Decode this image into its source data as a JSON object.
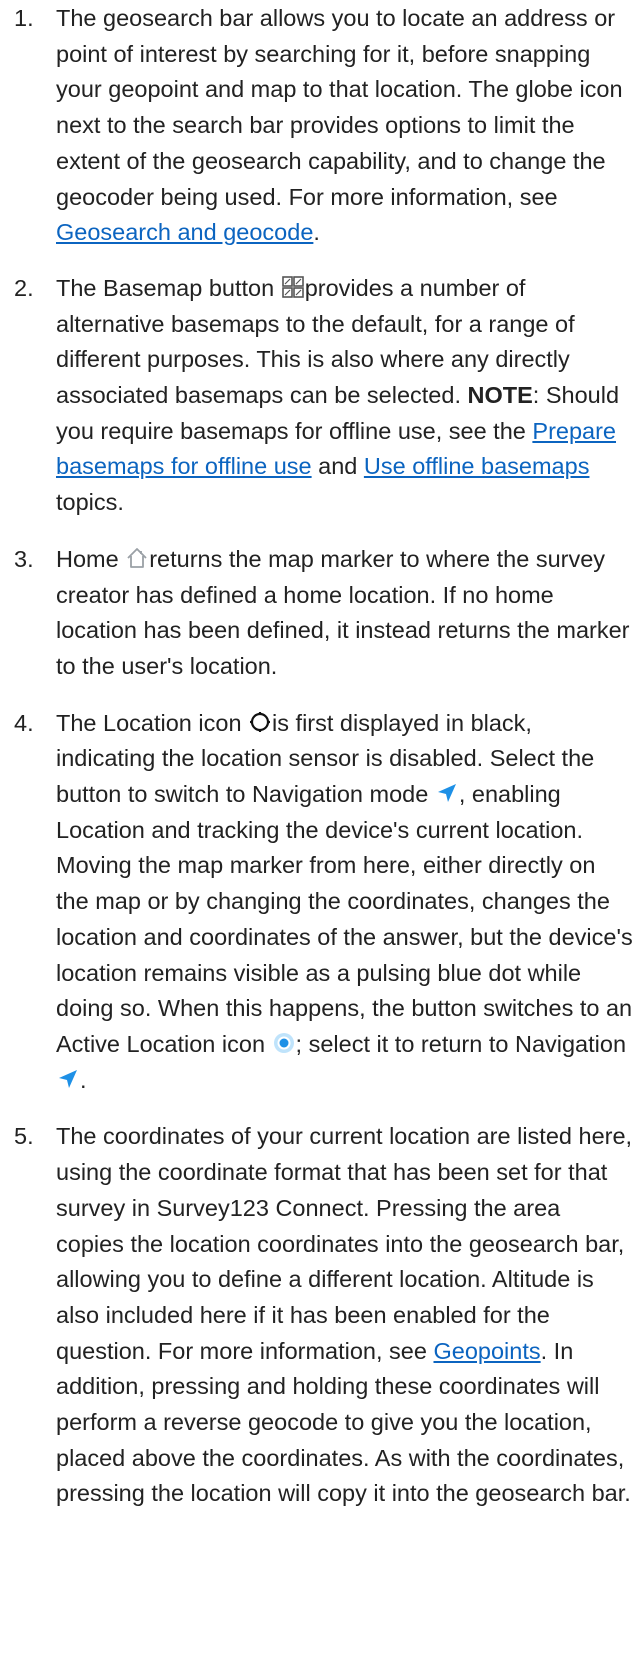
{
  "items": [
    {
      "number": "1.",
      "text": "The geosearch bar allows you to locate an address or point of interest by searching for it, before snapping your geopoint and map to that location. The globe icon next to the search bar provides options to limit the extent of the geosearch capability, and to change the geocoder being used. For more information, see ",
      "link": "Geosearch and geocode",
      "end": "."
    },
    {
      "number": "2.",
      "text_a": "The Basemap button ",
      "icon": "basemap-grid-icon",
      "text_b": "provides a number of alternative basemaps to the default, for a range of different purposes. This is also where any directly associated basemaps can be selected. ",
      "note_label": "NOTE",
      "text_c": ": Should you require basemaps for offline use, see the ",
      "link1": "Prepare basemaps for offline use",
      "text_d": " and ",
      "link2": "Use offline basemaps",
      "text_e": " topics."
    },
    {
      "number": "3.",
      "text_a": "Home ",
      "icon": "home-icon",
      "text_b": "returns the map marker to where the survey creator has defined a home location. If no home location has been defined, it instead returns the marker to the user's location."
    },
    {
      "number": "4.",
      "text_a": "The Location icon ",
      "icon1": "location-pin-outline-icon",
      "text_b": "is first displayed in black, indicating the location sensor is disabled. Select the button to switch to Navigation mode ",
      "icon2": "navigation-arrow-icon",
      "text_c": ", enabling Location and tracking the device's current location. Moving the map marker from here, either directly on the map or by changing the coordinates, changes the location and coordinates of the answer, but the device's location remains visible as a pulsing blue dot while doing so. When this happens, the button switches to an Active Location icon ",
      "icon3": "active-location-icon",
      "text_d": "; select it to return to Navigation ",
      "icon4": "navigation-arrow-icon",
      "text_e": "."
    },
    {
      "number": "5.",
      "text_a": "The coordinates of your current location are listed here, using the coordinate format that has been set for that survey in Survey123 Connect. Pressing the area copies the location coordinates into the geosearch bar, allowing you to define a different location. Altitude is also included here if it has been enabled for the question. For more information, see ",
      "link": "Geopoints",
      "text_b": ". In addition, pressing and holding these coordinates will perform a reverse geocode to give you the location, placed above the coordinates. As with the coordinates, pressing the location will copy it into the geosearch bar."
    }
  ],
  "colors": {
    "text": "#222222",
    "link": "#0b64c0",
    "icon_blue": "#1e90e6",
    "icon_gray": "#9aa0a6"
  }
}
